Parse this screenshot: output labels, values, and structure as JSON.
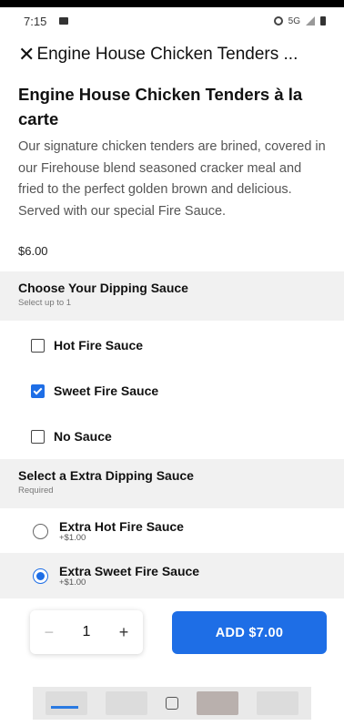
{
  "status": {
    "time": "7:15",
    "network": "5G"
  },
  "header": {
    "title": "Engine House Chicken Tenders ..."
  },
  "item": {
    "title": "Engine House Chicken Tenders à la carte",
    "description": "Our signature chicken tenders are brined, covered in our Firehouse blend seasoned cracker meal and fried to the perfect golden brown and delicious. Served with our special Fire Sauce.",
    "price": "$6.00"
  },
  "dipping": {
    "title": "Choose Your Dipping Sauce",
    "subtitle": "Select up to 1",
    "options": [
      {
        "label": "Hot Fire Sauce",
        "checked": false
      },
      {
        "label": "Sweet Fire Sauce",
        "checked": true
      },
      {
        "label": "No Sauce",
        "checked": false
      }
    ]
  },
  "extra": {
    "title": "Select a Extra Dipping Sauce",
    "subtitle": "Required",
    "options": [
      {
        "label": "Extra Hot Fire Sauce",
        "price": "+$1.00",
        "selected": false
      },
      {
        "label": "Extra Sweet Fire Sauce",
        "price": "+$1.00",
        "selected": true
      }
    ]
  },
  "cart": {
    "minus": "−",
    "quantity": "1",
    "plus": "+",
    "add_label": "ADD $7.00"
  },
  "colors": {
    "accent": "#1e6ee6",
    "section_bg": "#f1f1f1"
  }
}
